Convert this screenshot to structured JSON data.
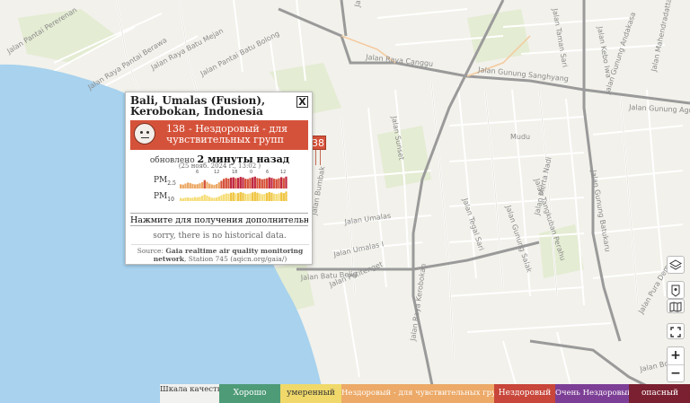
{
  "map": {
    "streets": [
      "Jalan Raya Canggu",
      "Jalan Gunung Sanghyang",
      "Jalan Gunung Agung",
      "Jalan Raya Pantai Berawa",
      "Jalan Raya Batu Mejan",
      "Jalan Pantai Batu Bolong",
      "Jalan Pantai Pererenan",
      "Jalan Bumbak",
      "Jalan Umalas",
      "Jalan Umalas I",
      "Jalan Batu Belig",
      "Jalan Petitenget",
      "Jalan Raya Kerobokan",
      "Jalan Sunset",
      "Jalan Gunung Salak",
      "Jalan Gunung Batukaru",
      "Jalan Mahendradatta",
      "Jalan Kebo Iwa",
      "Jalan Tangkuban Perahu",
      "Jalan Merta Nadi",
      "Jalan Gunung Andakasa",
      "Jalan Taman Sari",
      "Jalan Pura Demak",
      "Mudu",
      "Jalan Bonjol",
      "Jalan Raya Semer",
      "Jalan Tegal Sari"
    ]
  },
  "station_marker": {
    "value": "38"
  },
  "popup": {
    "title": "Bali, Umalas (Fusion), Kerobokan, Indonesia",
    "close_label": "X",
    "aqi": {
      "value": "138",
      "status": "- Нездоровый - для чувствительных групп",
      "color": "#d5523a"
    },
    "updated_prefix": "обновлено",
    "updated_ago": "2 минуты назад",
    "updated_date": "(25 нояб. 2024 г., 13:02 )",
    "pm25_label": "PM",
    "pm25_sub": "2.5",
    "pm10_label": "PM",
    "pm10_sub": "10",
    "hour_ticks": [
      "6",
      "12",
      "18",
      "0",
      "6",
      "12"
    ],
    "more_button": "Нажмите для получения дополнительной",
    "no_history": "sorry, there is no historical data.",
    "source_prefix": "Source:",
    "source_name": "Gaia realtime air quality monitoring network",
    "source_suffix": ", Station 745 (aqicn.org/gaia/)"
  },
  "chart_data": [
    {
      "type": "bar",
      "name": "PM2.5",
      "values": [
        60,
        55,
        70,
        85,
        78,
        66,
        58,
        62,
        74,
        90,
        120,
        96,
        70,
        58,
        52,
        64,
        88,
        110,
        138,
        150,
        142,
        155,
        160,
        148,
        152,
        166,
        158,
        140,
        136,
        150,
        160,
        170,
        150,
        144,
        132,
        138,
        146,
        160,
        152,
        140,
        134,
        146,
        162,
        150,
        170
      ],
      "ylim": [
        0,
        180
      ]
    },
    {
      "type": "bar",
      "name": "PM10",
      "values": [
        20,
        18,
        22,
        24,
        20,
        22,
        26,
        24,
        28,
        34,
        42,
        36,
        28,
        22,
        20,
        24,
        30,
        38,
        44,
        50,
        48,
        54,
        56,
        50,
        52,
        58,
        54,
        48,
        46,
        50,
        56,
        60,
        54,
        50,
        44,
        46,
        52,
        58,
        54,
        48,
        46,
        50,
        56,
        52,
        62
      ],
      "ylim": [
        0,
        70
      ]
    }
  ],
  "controls": {
    "layers_icon": "layers-icon",
    "location_icon": "location-icon",
    "map_icon": "map-icon",
    "fullscreen_icon": "fullscreen-icon",
    "zoom_in": "+",
    "zoom_out": "−"
  },
  "legend": {
    "scale_label": "Шкала качества",
    "good": "Хорошо",
    "moderate": "умеренный",
    "sensitive": "Нездоровый - для чувствительных групп",
    "unhealthy": "Нездоровый",
    "very_unhealthy": "Очень Нездоровый",
    "hazardous": "опасный"
  }
}
